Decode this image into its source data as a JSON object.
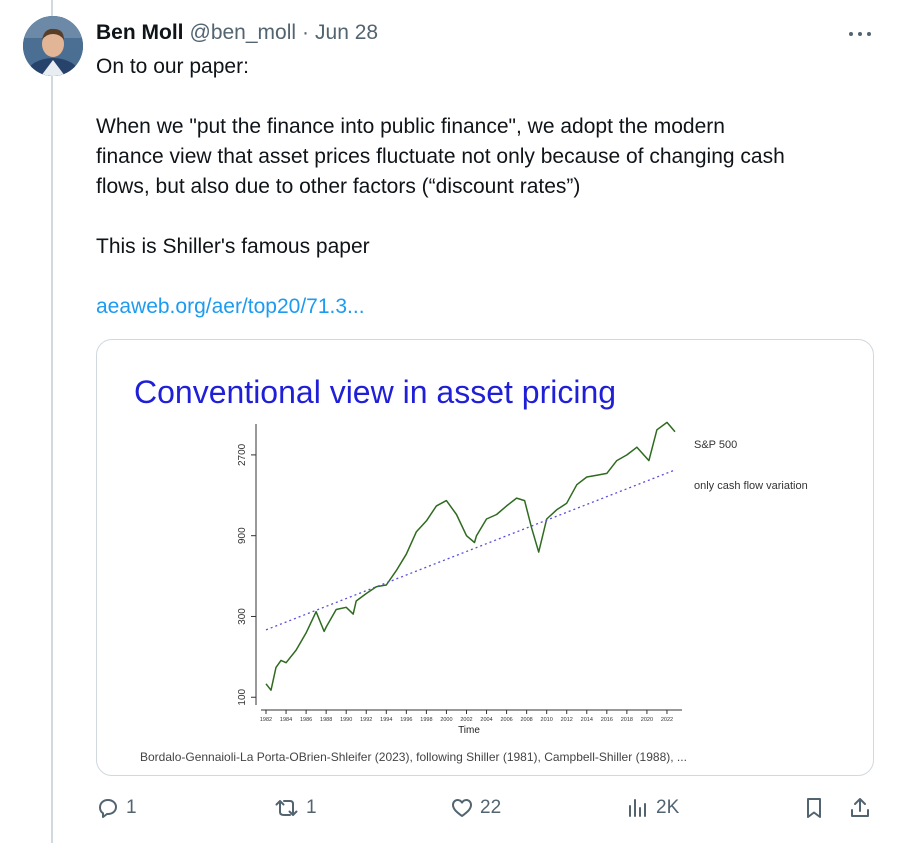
{
  "tweet": {
    "author_name": "Ben Moll",
    "handle": "@ben_moll",
    "separator": "·",
    "date": "Jun 28",
    "lines": [
      "On to our paper:",
      "When we \"put the finance into public finance\", we adopt the modern",
      "finance view that asset prices fluctuate not only because of changing cash",
      "flows, but also due to other factors (“discount rates”)",
      "This is Shiller's famous paper"
    ],
    "link": "aeaweb.org/aer/top20/71.3..."
  },
  "card": {
    "slide_title": "Conventional view in asset pricing",
    "credit": "Bordalo-Gennaioli-La Porta-OBrien-Shleifer (2023), following Shiller (1981), Campbell-Shiller (1988), ..."
  },
  "chart_data": {
    "type": "line",
    "title": "",
    "xlabel": "Time",
    "ylabel": "",
    "y_scale": "log",
    "ylim": [
      90,
      4000
    ],
    "xlim": [
      1981.5,
      2023.5
    ],
    "y_ticks": [
      100,
      300,
      900,
      2700
    ],
    "x_ticks": [
      "1982",
      "1984",
      "1986",
      "1988",
      "1990",
      "1992",
      "1994",
      "1996",
      "1998",
      "2000",
      "2002",
      "2004",
      "2006",
      "2008",
      "2010",
      "2012",
      "2014",
      "2016",
      "2018",
      "2020",
      "2022"
    ],
    "legend_placement": "right",
    "series": [
      {
        "name": "S&P 500",
        "color": "#2e6b1f",
        "style": "solid",
        "points": [
          [
            1982,
            120
          ],
          [
            1982.5,
            110
          ],
          [
            1983,
            150
          ],
          [
            1983.5,
            165
          ],
          [
            1984,
            160
          ],
          [
            1985,
            190
          ],
          [
            1986,
            240
          ],
          [
            1987,
            320
          ],
          [
            1987.8,
            245
          ],
          [
            1988,
            260
          ],
          [
            1989,
            330
          ],
          [
            1990,
            340
          ],
          [
            1990.7,
            310
          ],
          [
            1991,
            370
          ],
          [
            1992,
            410
          ],
          [
            1993,
            450
          ],
          [
            1994,
            460
          ],
          [
            1995,
            560
          ],
          [
            1996,
            700
          ],
          [
            1997,
            950
          ],
          [
            1998,
            1100
          ],
          [
            1999,
            1350
          ],
          [
            2000,
            1450
          ],
          [
            2001,
            1200
          ],
          [
            2002,
            900
          ],
          [
            2002.8,
            820
          ],
          [
            2003,
            900
          ],
          [
            2004,
            1130
          ],
          [
            2005,
            1200
          ],
          [
            2006,
            1350
          ],
          [
            2007,
            1500
          ],
          [
            2007.8,
            1450
          ],
          [
            2008.5,
            1000
          ],
          [
            2009.2,
            720
          ],
          [
            2010,
            1130
          ],
          [
            2011,
            1280
          ],
          [
            2012,
            1400
          ],
          [
            2013,
            1800
          ],
          [
            2014,
            2000
          ],
          [
            2015,
            2050
          ],
          [
            2016,
            2100
          ],
          [
            2017,
            2500
          ],
          [
            2018,
            2700
          ],
          [
            2019,
            3000
          ],
          [
            2020.2,
            2500
          ],
          [
            2021,
            3800
          ],
          [
            2022,
            4200
          ],
          [
            2022.8,
            3700
          ]
        ]
      },
      {
        "name": "only cash flow variation",
        "color": "#5b4fd9",
        "style": "dotted",
        "start": [
          1982,
          250
        ],
        "end": [
          2022.8,
          2200
        ]
      }
    ]
  },
  "actions": {
    "reply_count": "1",
    "repost_count": "1",
    "like_count": "22",
    "views_count": "2K"
  },
  "icons": [
    "more-icon",
    "reply-icon",
    "repost-icon",
    "like-icon",
    "views-icon",
    "bookmark-icon",
    "share-icon"
  ]
}
